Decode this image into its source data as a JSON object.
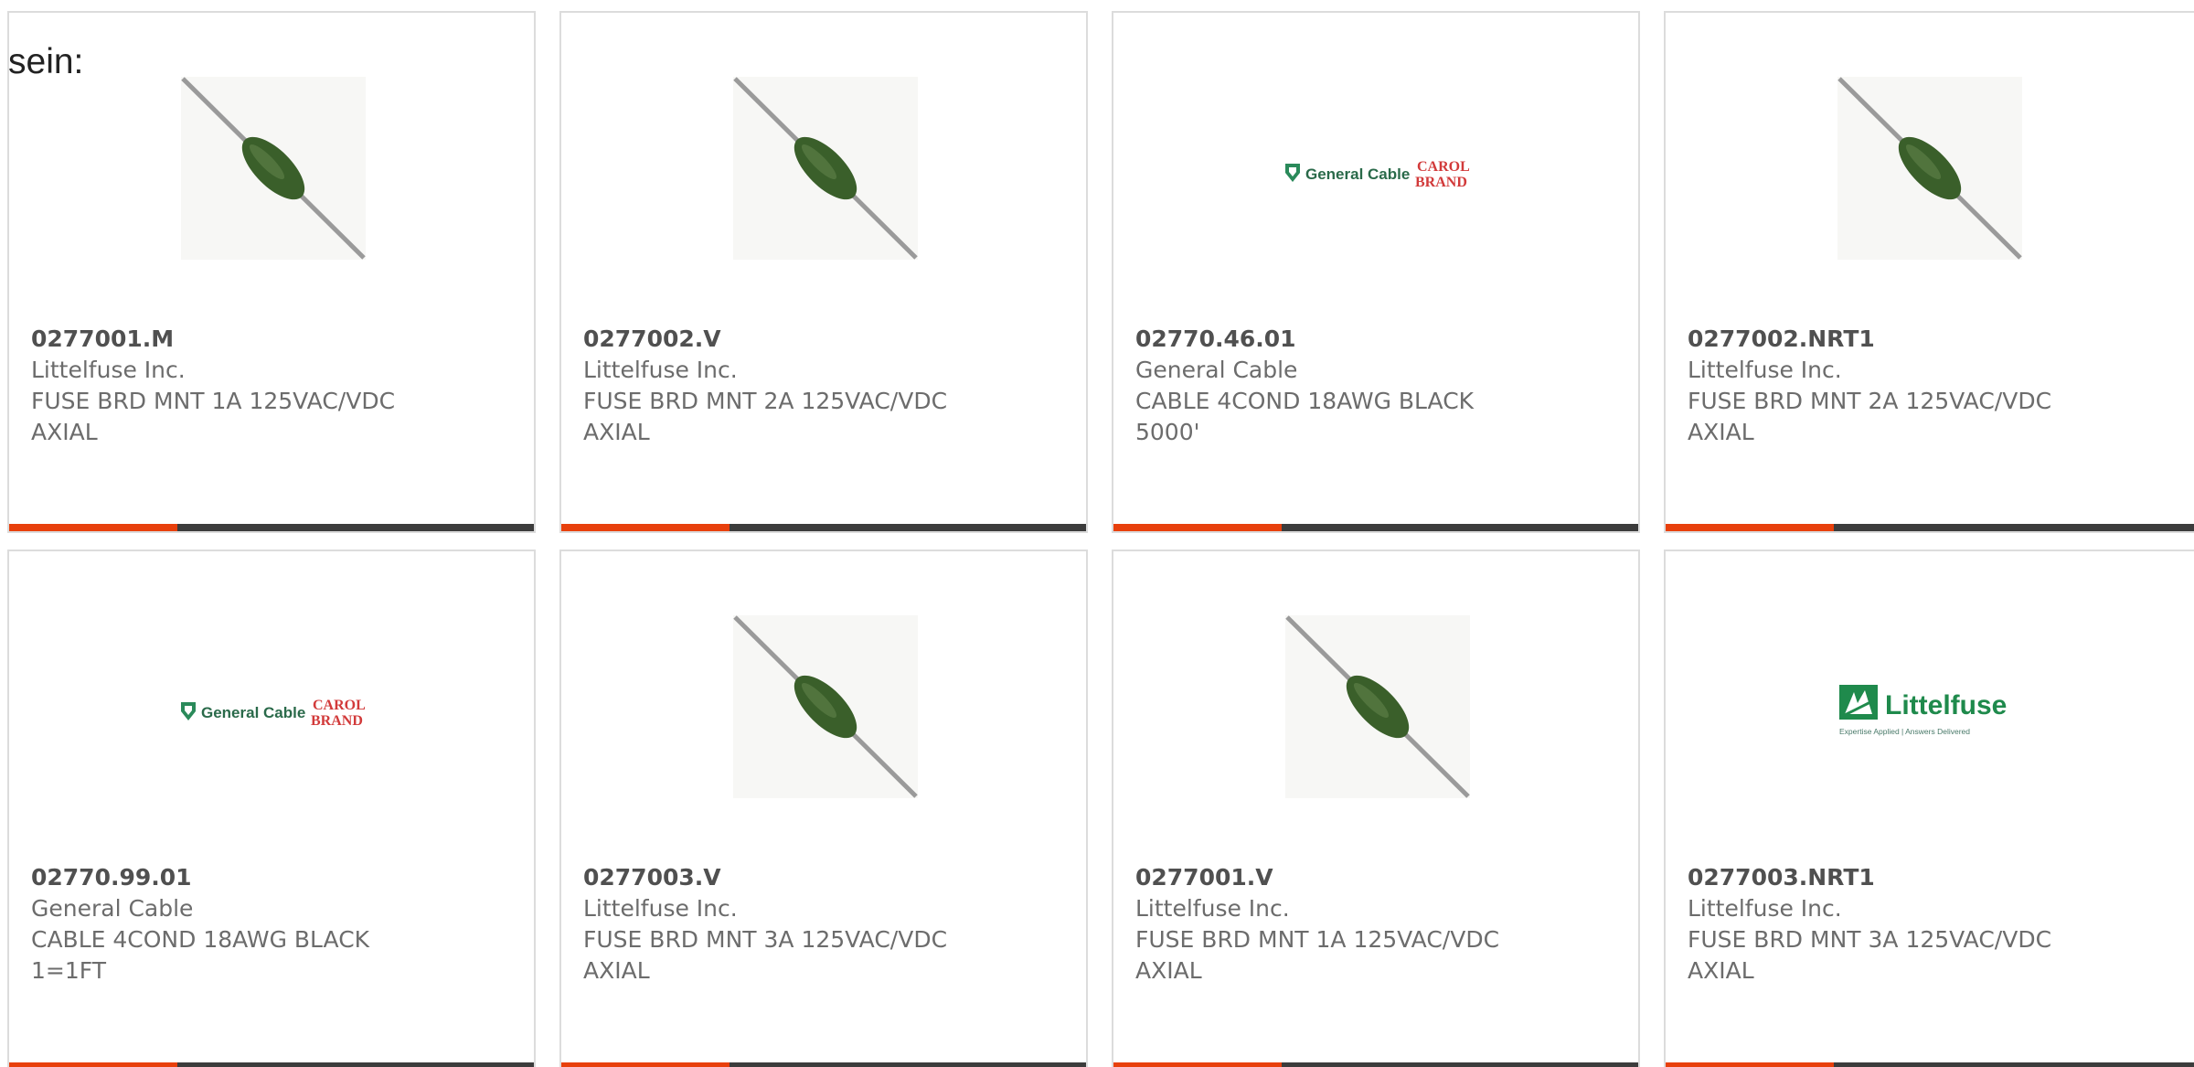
{
  "leading_text": "sein:",
  "colors": {
    "accent_bar": "#e8400c",
    "dark_bar": "#3c3c3c",
    "fuse_body": "#3a5f2a",
    "general_cable_green": "#2a8a5a",
    "carol_brand_red": "#d23a3a",
    "littelfuse_green": "#1f8a4c"
  },
  "logos": {
    "general_cable_text": "General Cable",
    "carol_text": "CAROL",
    "brand_text": "BRAND",
    "littelfuse_text": "Littelfuse",
    "littelfuse_tagline": "Expertise Applied | Answers Delivered"
  },
  "products": [
    {
      "part": "0277001.M",
      "manufacturer": "Littelfuse Inc.",
      "description": "FUSE BRD MNT 1A 125VAC/VDC AXIAL",
      "image": "fuse-image"
    },
    {
      "part": "0277002.V",
      "manufacturer": "Littelfuse Inc.",
      "description": "FUSE BRD MNT 2A 125VAC/VDC AXIAL",
      "image": "fuse-image"
    },
    {
      "part": "02770.46.01",
      "manufacturer": "General Cable",
      "description": "CABLE 4COND 18AWG BLACK 5000'",
      "image": "general-cable-logo"
    },
    {
      "part": "0277002.NRT1",
      "manufacturer": "Littelfuse Inc.",
      "description": "FUSE BRD MNT 2A 125VAC/VDC AXIAL",
      "image": "fuse-image"
    },
    {
      "part": "02770.99.01",
      "manufacturer": "General Cable",
      "description": "CABLE 4COND 18AWG BLACK 1=1FT",
      "image": "general-cable-logo"
    },
    {
      "part": "0277003.V",
      "manufacturer": "Littelfuse Inc.",
      "description": "FUSE BRD MNT 3A 125VAC/VDC AXIAL",
      "image": "fuse-image"
    },
    {
      "part": "0277001.V",
      "manufacturer": "Littelfuse Inc.",
      "description": "FUSE BRD MNT 1A 125VAC/VDC AXIAL",
      "image": "fuse-image"
    },
    {
      "part": "0277003.NRT1",
      "manufacturer": "Littelfuse Inc.",
      "description": "FUSE BRD MNT 3A 125VAC/VDC AXIAL",
      "image": "littelfuse-logo"
    }
  ]
}
